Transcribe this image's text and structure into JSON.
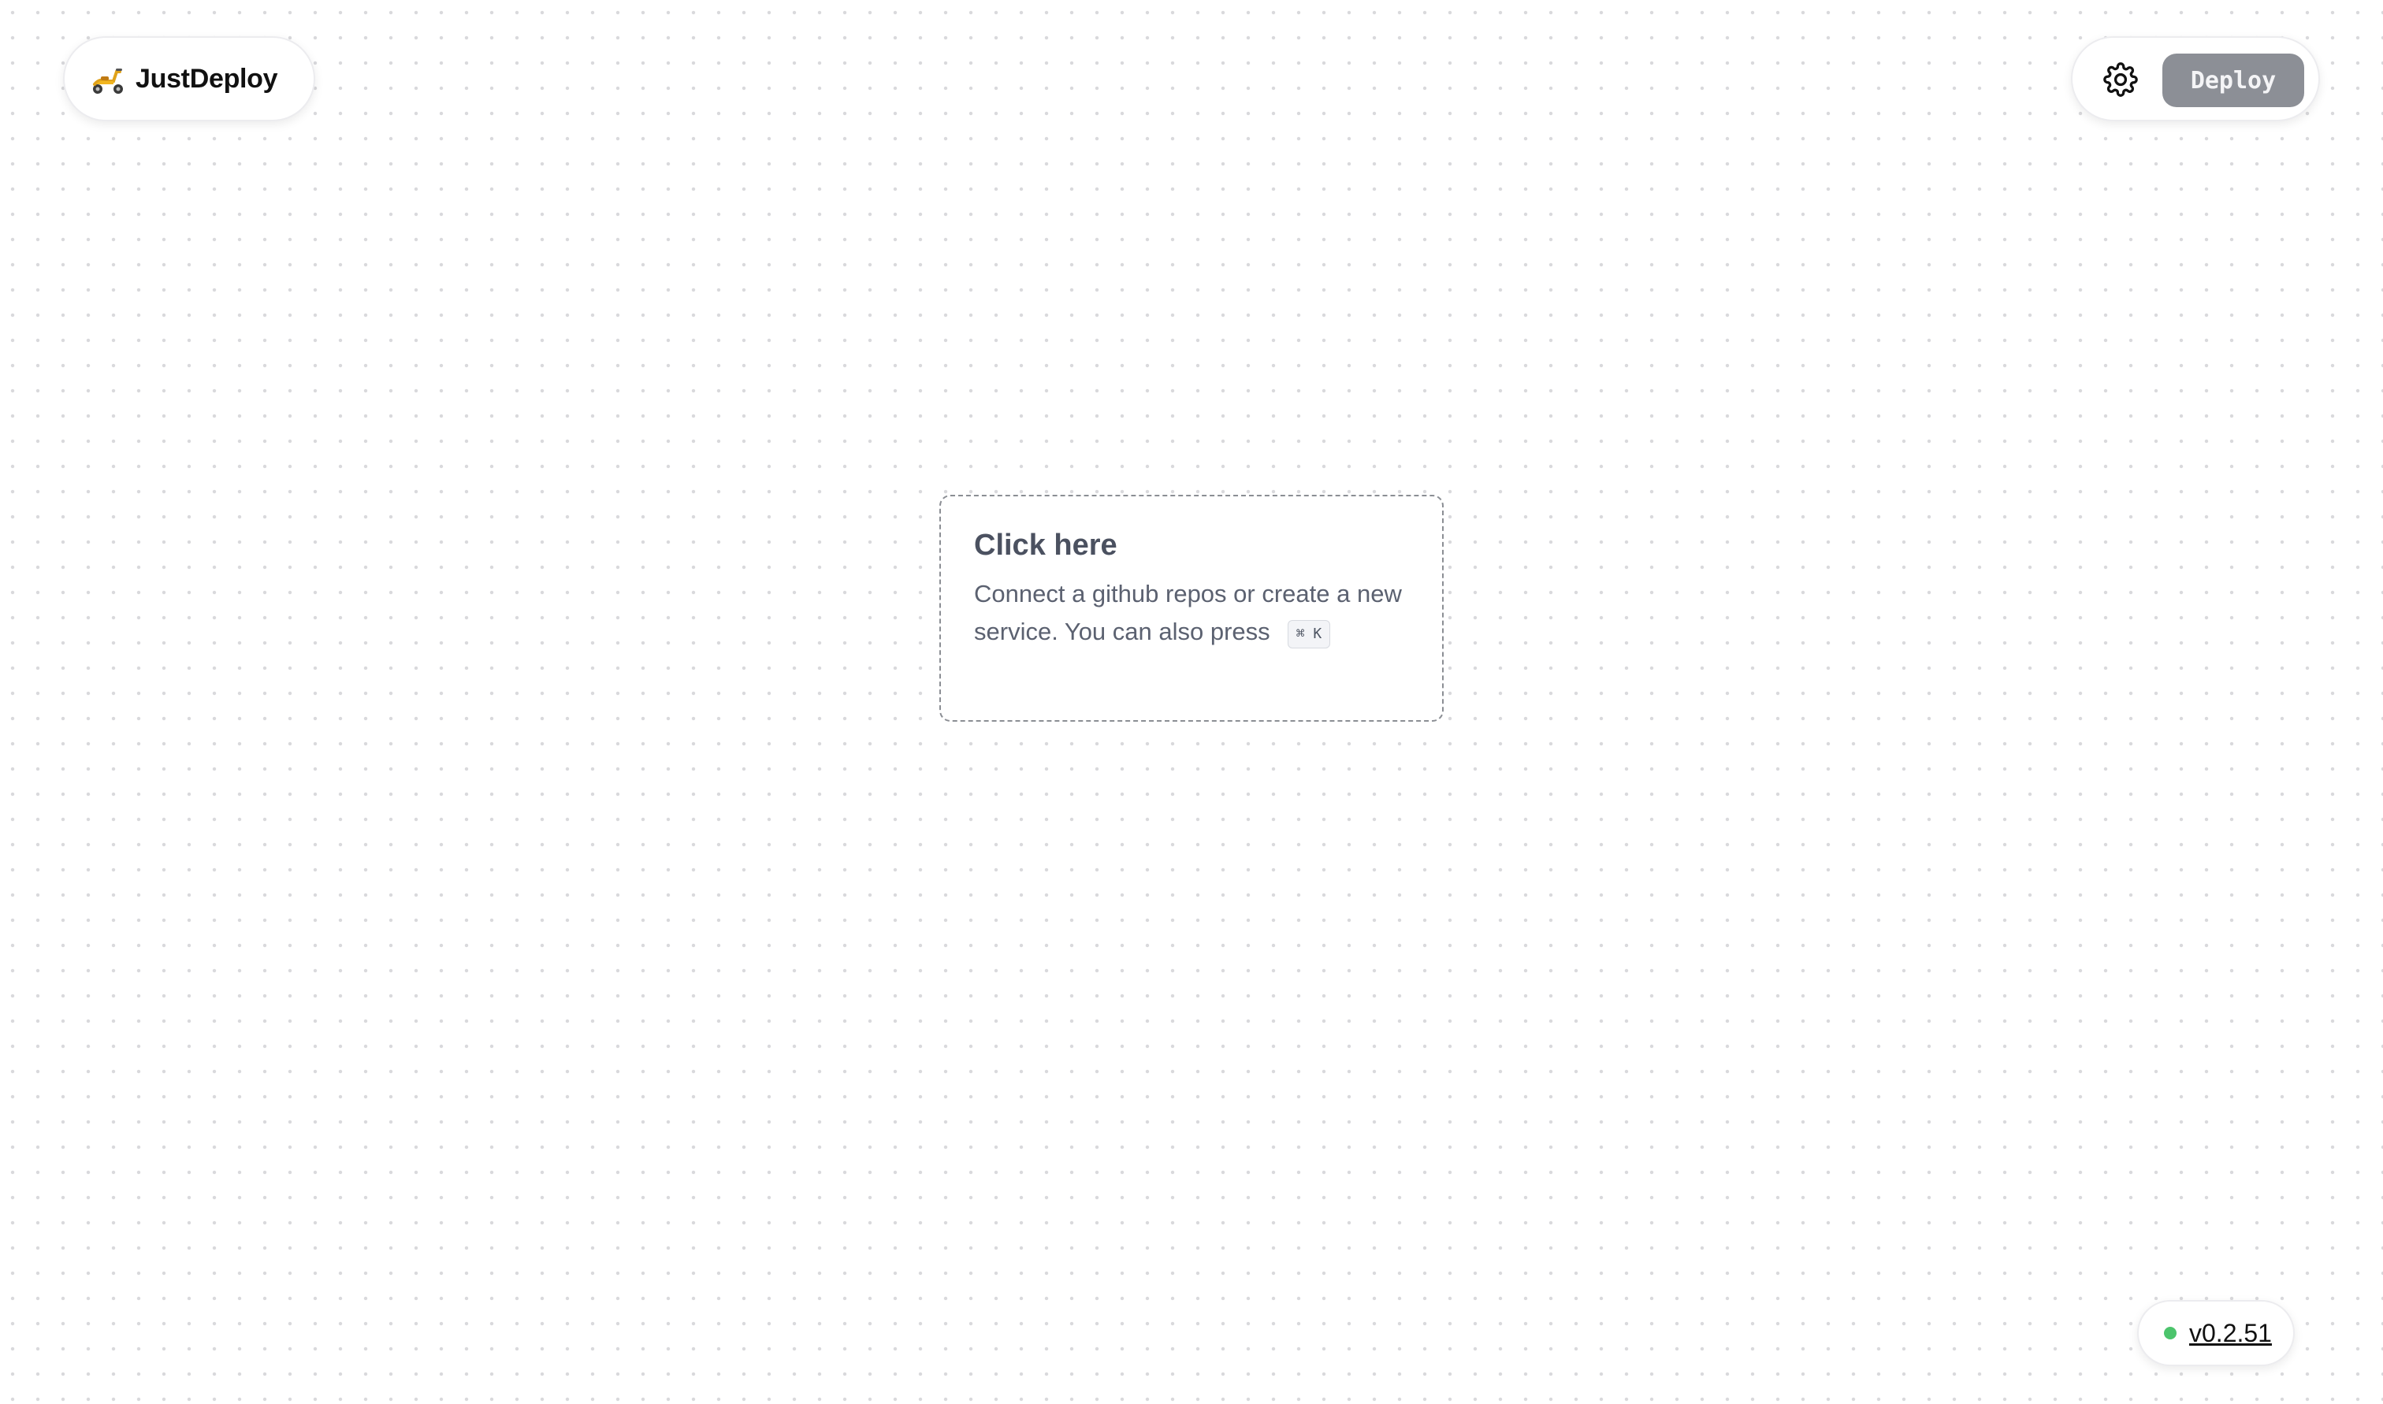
{
  "brand": {
    "name": "JustDeploy",
    "logo_icon": "scooter-icon"
  },
  "toolbar": {
    "settings_icon": "gear-icon",
    "deploy_label": "Deploy"
  },
  "empty_state": {
    "title": "Click here",
    "description": "Connect a github repos or create a new service. You can also press",
    "shortcut": "⌘ K"
  },
  "status": {
    "version": "v0.2.51",
    "status_color": "#4cc46c"
  },
  "colors": {
    "deploy_button_bg": "#8c8f96",
    "card_border": "#8b8e94"
  }
}
